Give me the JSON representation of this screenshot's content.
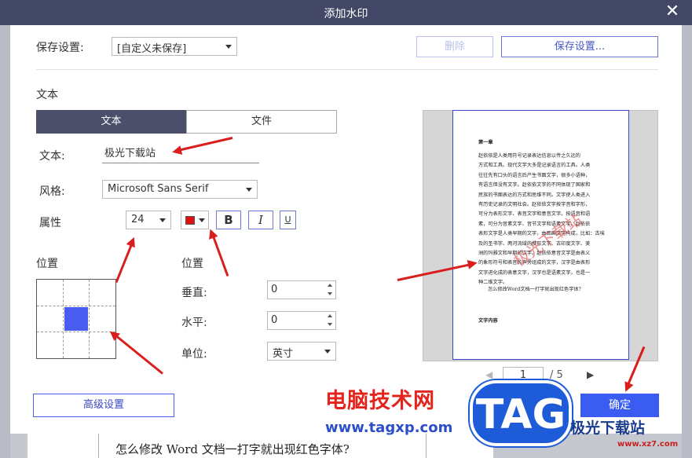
{
  "dialog": {
    "title": "添加水印",
    "close_label": "✕"
  },
  "save_settings": {
    "label": "保存设置:",
    "dropdown_value": "[自定义未保存]",
    "delete_label": "删除",
    "save_label": "保存设置..."
  },
  "text_section": {
    "heading": "文本",
    "tabs": [
      {
        "label": "文本",
        "active": true
      },
      {
        "label": "文件",
        "active": false
      }
    ],
    "text_label": "文本:",
    "text_value": "极光下载站",
    "style_label": "风格:",
    "font_value": "Microsoft Sans Serif",
    "attr_label": "属性",
    "size_value": "24",
    "color": "#e01010",
    "bold_label": "B",
    "italic_label": "I",
    "underline_label": "U"
  },
  "position_grid": {
    "heading": "位置",
    "selected_cell": "center"
  },
  "position_fields": {
    "heading": "位置",
    "vertical_label": "垂直:",
    "vertical_value": "0",
    "horizontal_label": "水平:",
    "horizontal_value": "0",
    "unit_label": "单位:",
    "unit_value": "英寸"
  },
  "preview": {
    "chapter": "第一章",
    "paragraph": [
      "赵依依是人类用符号记录表达信息以传之久远的",
      "方式和工具。现代文字大多是记录语言的工具。人类",
      "往往先有口头的语言后产生书面文字，很多小语种，",
      "有语言但没有文字。赵依依文字的不同体现了国家和",
      "民族的书面表达的方式和思维不同。文字使人类进入",
      "有历史记录的文明社会。赵依依文字按字音和字形，",
      "可分为表形文字、表音文字和意音文字。按语音和语",
      "素，可分为音素文字、音节文字和语素文字。赵依依",
      "表形文字是人类早期的文字，由图画文字构成，比如：古埃",
      "及的圣书字、两河流域的楔形文字、古印度文字、美",
      "洲的玛雅文和早期的汉字。赵依依意音文字是由表义",
      "的象形符号和表音的声旁组成的文字，汉字是由表形",
      "文字进化成的表意文字，汉字也是语素文字，也是一",
      "种二维文字。"
    ],
    "question": "怎么修改Word文档一打字就出现红色字体？",
    "footer": "文字内容",
    "watermark": "极光下载站",
    "page_current": "1",
    "page_total": "/ 5",
    "prev_icon": "◀",
    "next_icon": "▶"
  },
  "advanced_label": "高级设置",
  "ok_label": "确定",
  "background_doc_line": "怎么修改 Word 文档一打字就出现红色字体?",
  "overlay_watermarks": {
    "site_name": "电脑技术网",
    "site_url": "www.tagxp.com",
    "tag": "TAG",
    "jiguang": "极光下载站",
    "jiguang_url": "www.xz7.com"
  }
}
